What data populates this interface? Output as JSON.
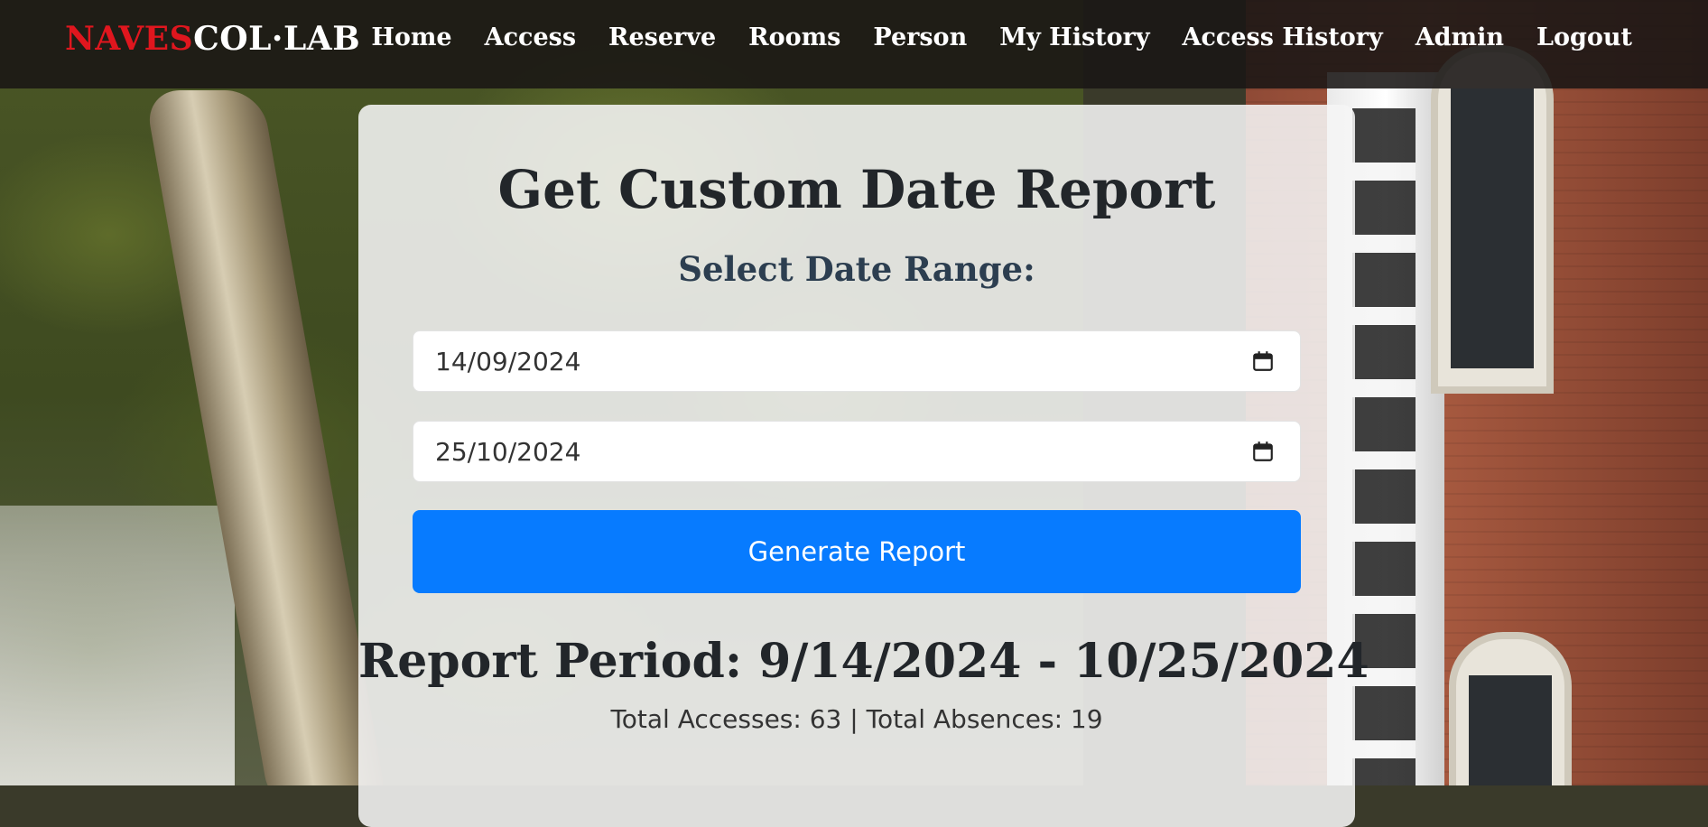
{
  "brand": {
    "part1": "NAVES",
    "part2": "COL·LAB"
  },
  "nav": [
    "Home",
    "Access",
    "Reserve",
    "Rooms",
    "Person",
    "My History",
    "Access History",
    "Admin",
    "Logout"
  ],
  "report": {
    "title": "Get Custom Date Report",
    "subtitle": "Select Date Range:",
    "start_date": "14/09/2024",
    "end_date": "25/10/2024",
    "button_label": "Generate Report",
    "period_label": "Report Period: 9/14/2024 - 10/25/2024",
    "totals": "Total Accesses: 63 | Total Absences: 19"
  },
  "colors": {
    "brand_red": "#e0161e",
    "primary_button": "#077bff",
    "navbar_bg": "#191614"
  },
  "icons": {
    "date_picker": "calendar-icon"
  }
}
